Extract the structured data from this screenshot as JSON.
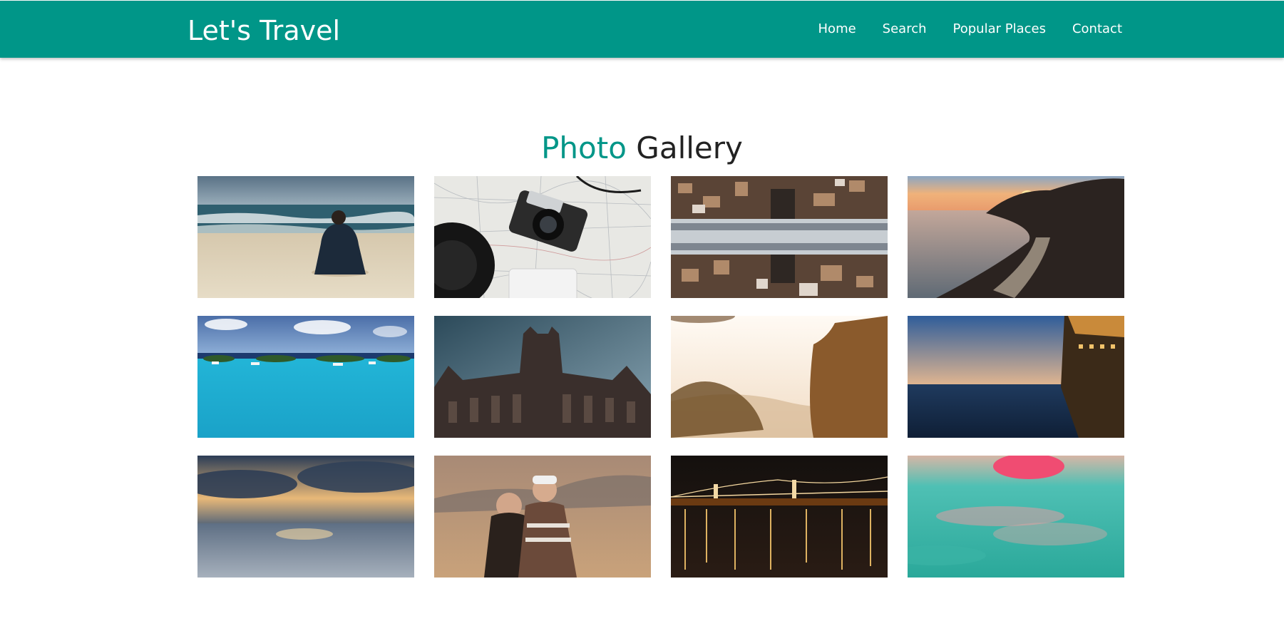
{
  "navbar": {
    "brand": "Let's Travel",
    "links": [
      {
        "label": "Home"
      },
      {
        "label": "Search"
      },
      {
        "label": "Popular Places"
      },
      {
        "label": "Contact"
      }
    ],
    "background": "#009688"
  },
  "gallery": {
    "title_accent": "Photo",
    "title_rest": "Gallery",
    "accent_color": "#009688",
    "photos": [
      {
        "subject": "man-sitting-on-beach"
      },
      {
        "subject": "camera-on-map"
      },
      {
        "subject": "mirrored-city"
      },
      {
        "subject": "sunset-coastline"
      },
      {
        "subject": "tropical-lagoon"
      },
      {
        "subject": "gothic-building"
      },
      {
        "subject": "misty-forest-cliff"
      },
      {
        "subject": "ship-deck-sea"
      },
      {
        "subject": "cloudy-sea-sunset"
      },
      {
        "subject": "couple-portrait"
      },
      {
        "subject": "bridge-at-night"
      },
      {
        "subject": "underwater-pink-float"
      }
    ]
  }
}
